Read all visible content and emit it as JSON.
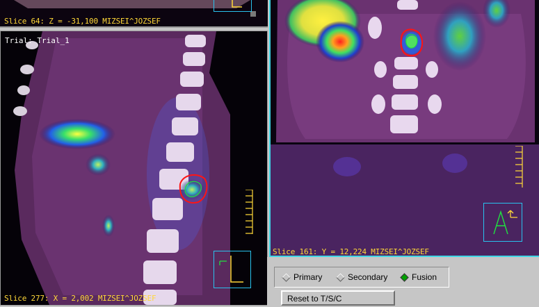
{
  "viewports": {
    "axial": {
      "slice_label": "Slice 64: Z = -31,100 MIZSEI^JOZSEF"
    },
    "sagittal": {
      "trial_label": "Trial: Trial_1",
      "slice_label": "Slice 277: X = 2,002 MIZSEI^JOZSEF"
    },
    "coronal": {
      "slice_label": "Slice 161: Y = 12,224 MIZSEI^JOZSEF"
    }
  },
  "display_mode": {
    "options": [
      {
        "label": "Primary",
        "selected": false
      },
      {
        "label": "Secondary",
        "selected": false
      },
      {
        "label": "Fusion",
        "selected": true
      }
    ]
  },
  "buttons": {
    "reset_label": "Reset to T/S/C"
  },
  "colors": {
    "label_yellow": "#ffd838",
    "contour_red": "#ff1414",
    "orientation_cyan": "#29c3ee",
    "radio_selected": "#00a000",
    "panel_gray": "#c6c6c6"
  },
  "icons": {
    "radio": "diamond-radio-icon",
    "orientation_sagittal": "sagittal-orientation-icon",
    "orientation_coronal": "anterior-orientation-icon"
  }
}
